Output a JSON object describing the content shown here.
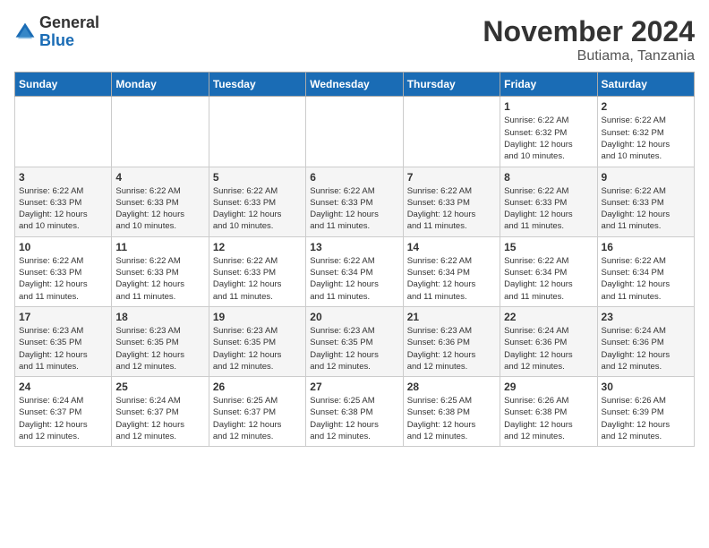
{
  "header": {
    "logo_general": "General",
    "logo_blue": "Blue",
    "month_title": "November 2024",
    "location": "Butiama, Tanzania"
  },
  "days_of_week": [
    "Sunday",
    "Monday",
    "Tuesday",
    "Wednesday",
    "Thursday",
    "Friday",
    "Saturday"
  ],
  "weeks": [
    [
      {
        "day": "",
        "info": ""
      },
      {
        "day": "",
        "info": ""
      },
      {
        "day": "",
        "info": ""
      },
      {
        "day": "",
        "info": ""
      },
      {
        "day": "",
        "info": ""
      },
      {
        "day": "1",
        "info": "Sunrise: 6:22 AM\nSunset: 6:32 PM\nDaylight: 12 hours\nand 10 minutes."
      },
      {
        "day": "2",
        "info": "Sunrise: 6:22 AM\nSunset: 6:32 PM\nDaylight: 12 hours\nand 10 minutes."
      }
    ],
    [
      {
        "day": "3",
        "info": "Sunrise: 6:22 AM\nSunset: 6:33 PM\nDaylight: 12 hours\nand 10 minutes."
      },
      {
        "day": "4",
        "info": "Sunrise: 6:22 AM\nSunset: 6:33 PM\nDaylight: 12 hours\nand 10 minutes."
      },
      {
        "day": "5",
        "info": "Sunrise: 6:22 AM\nSunset: 6:33 PM\nDaylight: 12 hours\nand 10 minutes."
      },
      {
        "day": "6",
        "info": "Sunrise: 6:22 AM\nSunset: 6:33 PM\nDaylight: 12 hours\nand 11 minutes."
      },
      {
        "day": "7",
        "info": "Sunrise: 6:22 AM\nSunset: 6:33 PM\nDaylight: 12 hours\nand 11 minutes."
      },
      {
        "day": "8",
        "info": "Sunrise: 6:22 AM\nSunset: 6:33 PM\nDaylight: 12 hours\nand 11 minutes."
      },
      {
        "day": "9",
        "info": "Sunrise: 6:22 AM\nSunset: 6:33 PM\nDaylight: 12 hours\nand 11 minutes."
      }
    ],
    [
      {
        "day": "10",
        "info": "Sunrise: 6:22 AM\nSunset: 6:33 PM\nDaylight: 12 hours\nand 11 minutes."
      },
      {
        "day": "11",
        "info": "Sunrise: 6:22 AM\nSunset: 6:33 PM\nDaylight: 12 hours\nand 11 minutes."
      },
      {
        "day": "12",
        "info": "Sunrise: 6:22 AM\nSunset: 6:33 PM\nDaylight: 12 hours\nand 11 minutes."
      },
      {
        "day": "13",
        "info": "Sunrise: 6:22 AM\nSunset: 6:34 PM\nDaylight: 12 hours\nand 11 minutes."
      },
      {
        "day": "14",
        "info": "Sunrise: 6:22 AM\nSunset: 6:34 PM\nDaylight: 12 hours\nand 11 minutes."
      },
      {
        "day": "15",
        "info": "Sunrise: 6:22 AM\nSunset: 6:34 PM\nDaylight: 12 hours\nand 11 minutes."
      },
      {
        "day": "16",
        "info": "Sunrise: 6:22 AM\nSunset: 6:34 PM\nDaylight: 12 hours\nand 11 minutes."
      }
    ],
    [
      {
        "day": "17",
        "info": "Sunrise: 6:23 AM\nSunset: 6:35 PM\nDaylight: 12 hours\nand 11 minutes."
      },
      {
        "day": "18",
        "info": "Sunrise: 6:23 AM\nSunset: 6:35 PM\nDaylight: 12 hours\nand 12 minutes."
      },
      {
        "day": "19",
        "info": "Sunrise: 6:23 AM\nSunset: 6:35 PM\nDaylight: 12 hours\nand 12 minutes."
      },
      {
        "day": "20",
        "info": "Sunrise: 6:23 AM\nSunset: 6:35 PM\nDaylight: 12 hours\nand 12 minutes."
      },
      {
        "day": "21",
        "info": "Sunrise: 6:23 AM\nSunset: 6:36 PM\nDaylight: 12 hours\nand 12 minutes."
      },
      {
        "day": "22",
        "info": "Sunrise: 6:24 AM\nSunset: 6:36 PM\nDaylight: 12 hours\nand 12 minutes."
      },
      {
        "day": "23",
        "info": "Sunrise: 6:24 AM\nSunset: 6:36 PM\nDaylight: 12 hours\nand 12 minutes."
      }
    ],
    [
      {
        "day": "24",
        "info": "Sunrise: 6:24 AM\nSunset: 6:37 PM\nDaylight: 12 hours\nand 12 minutes."
      },
      {
        "day": "25",
        "info": "Sunrise: 6:24 AM\nSunset: 6:37 PM\nDaylight: 12 hours\nand 12 minutes."
      },
      {
        "day": "26",
        "info": "Sunrise: 6:25 AM\nSunset: 6:37 PM\nDaylight: 12 hours\nand 12 minutes."
      },
      {
        "day": "27",
        "info": "Sunrise: 6:25 AM\nSunset: 6:38 PM\nDaylight: 12 hours\nand 12 minutes."
      },
      {
        "day": "28",
        "info": "Sunrise: 6:25 AM\nSunset: 6:38 PM\nDaylight: 12 hours\nand 12 minutes."
      },
      {
        "day": "29",
        "info": "Sunrise: 6:26 AM\nSunset: 6:38 PM\nDaylight: 12 hours\nand 12 minutes."
      },
      {
        "day": "30",
        "info": "Sunrise: 6:26 AM\nSunset: 6:39 PM\nDaylight: 12 hours\nand 12 minutes."
      }
    ]
  ]
}
